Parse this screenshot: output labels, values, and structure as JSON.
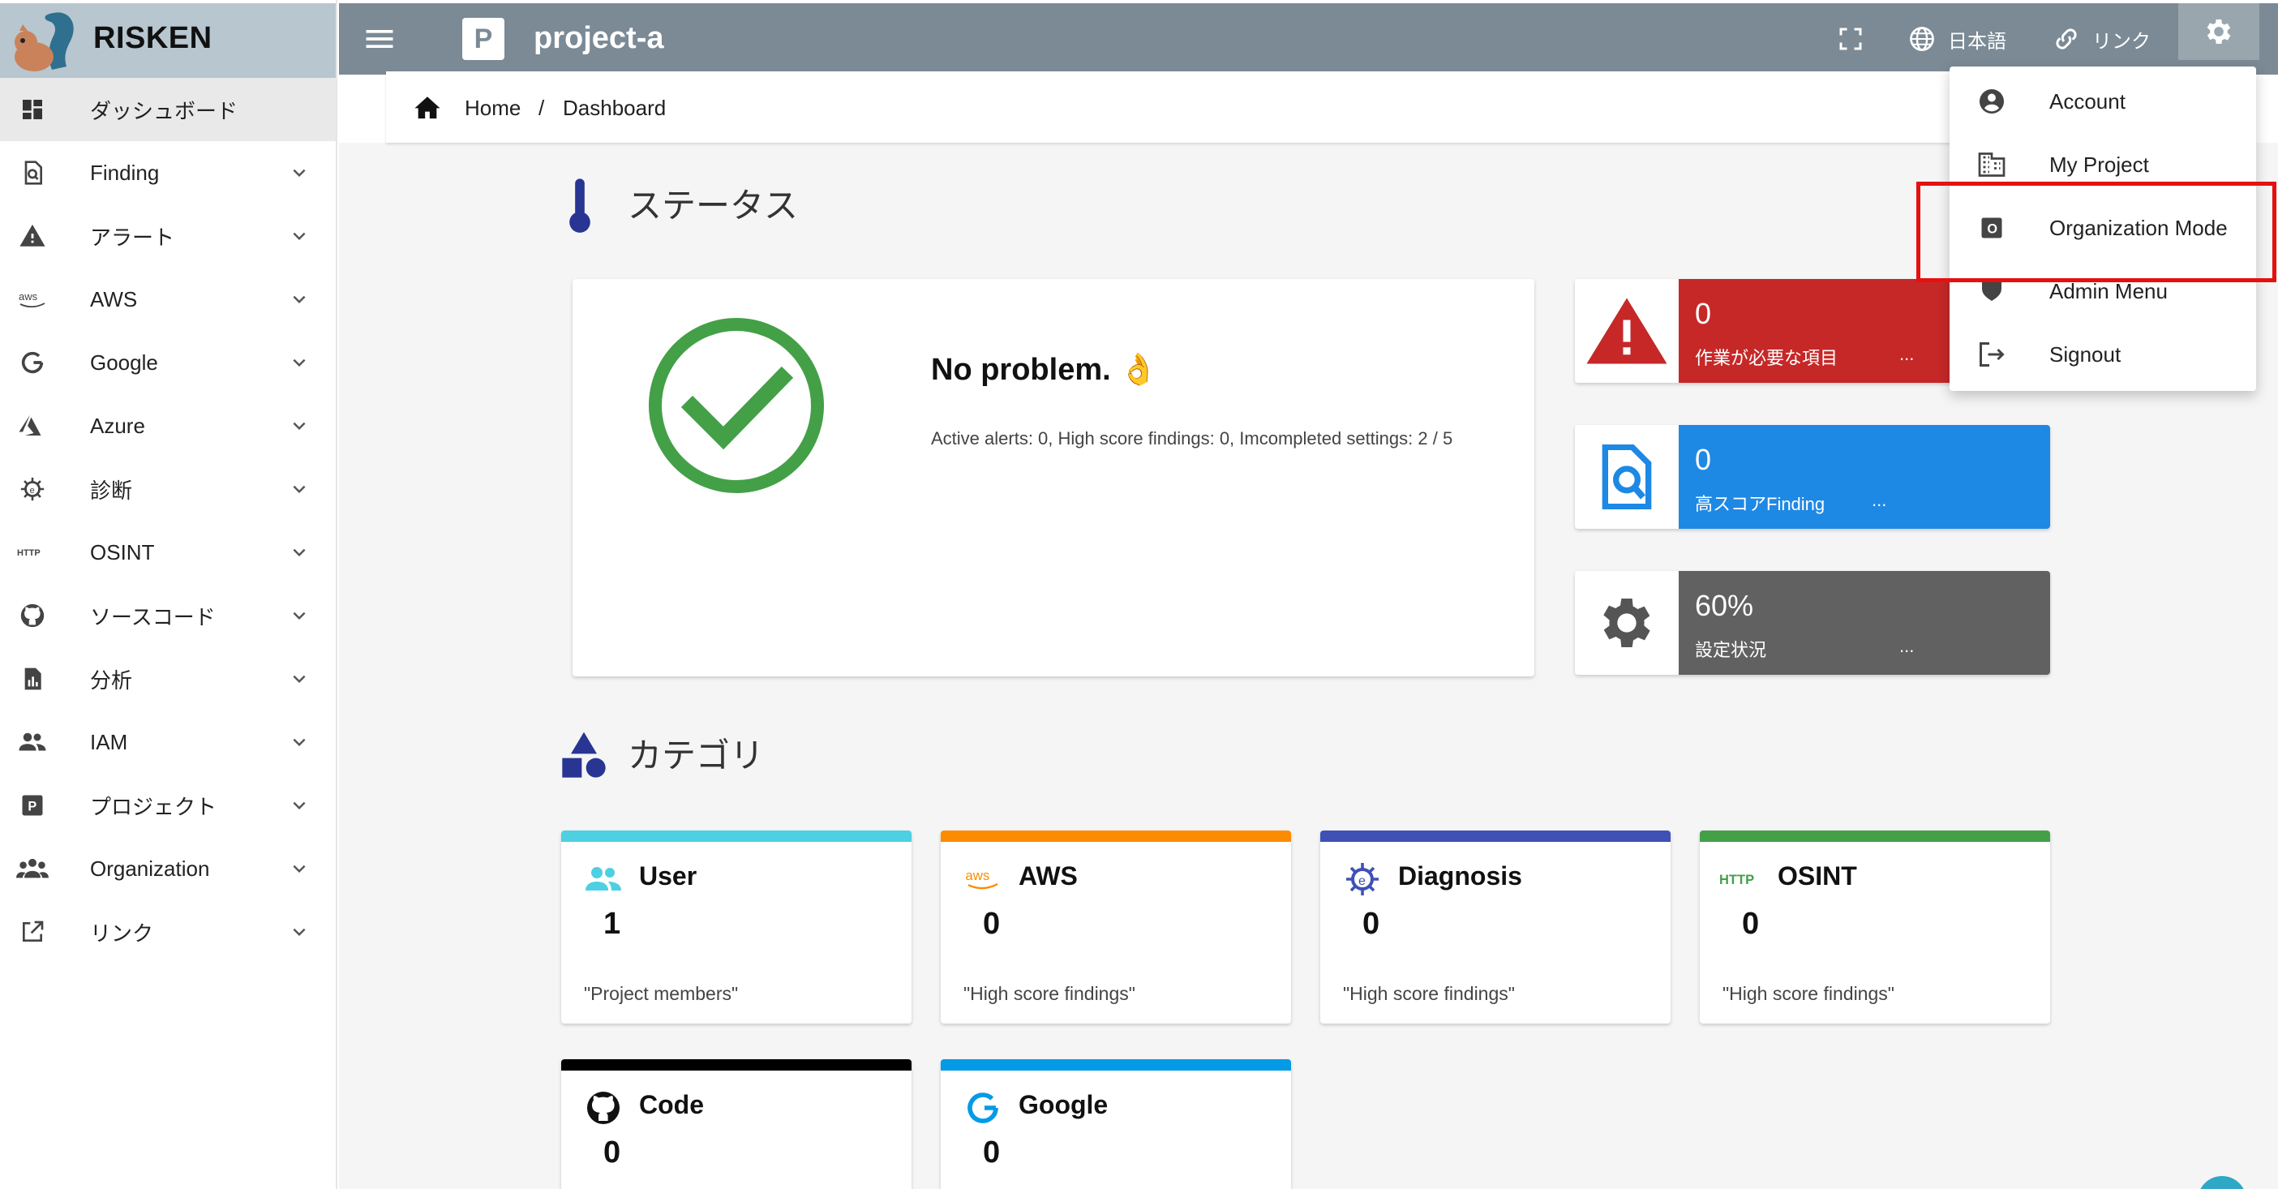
{
  "app": {
    "name": "RISKEN"
  },
  "sidebar": {
    "items": [
      {
        "label": "ダッシュボード",
        "icon": "dashboard-icon",
        "active": true
      },
      {
        "label": "Finding",
        "icon": "finding-icon"
      },
      {
        "label": "アラート",
        "icon": "alert-icon"
      },
      {
        "label": "AWS",
        "icon": "aws-icon"
      },
      {
        "label": "Google",
        "icon": "google-icon"
      },
      {
        "label": "Azure",
        "icon": "azure-icon"
      },
      {
        "label": "診断",
        "icon": "diagnosis-icon"
      },
      {
        "label": "OSINT",
        "icon": "http-icon"
      },
      {
        "label": "ソースコード",
        "icon": "github-icon"
      },
      {
        "label": "分析",
        "icon": "analysis-icon"
      },
      {
        "label": "IAM",
        "icon": "iam-icon"
      },
      {
        "label": "プロジェクト",
        "icon": "project-icon"
      },
      {
        "label": "Organization",
        "icon": "organization-icon"
      },
      {
        "label": "リンク",
        "icon": "link-icon"
      }
    ]
  },
  "header": {
    "project_badge": "P",
    "project_name": "project-a",
    "language_label": "日本語",
    "link_label": "リンク"
  },
  "breadcrumb": {
    "home": "Home",
    "separator": "/",
    "current": "Dashboard"
  },
  "status": {
    "title": "ステータス",
    "headline": "No problem. 👌",
    "summary": "Active alerts: 0, High score findings: 0, Imcompleted settings: 2 / 5"
  },
  "stats": [
    {
      "value": "0",
      "label": "作業が必要な項目",
      "dots": "...",
      "color": "#c62828"
    },
    {
      "value": "0",
      "label": "高スコアFinding",
      "dots": "...",
      "color": "#1e88e5"
    },
    {
      "value": "60%",
      "label": "設定状況",
      "dots": "...",
      "color": "#616161"
    }
  ],
  "category": {
    "title": "カテゴリ",
    "cards": [
      {
        "name": "User",
        "value": "1",
        "desc": "\"Project members\"",
        "color": "#4dd0e1"
      },
      {
        "name": "AWS",
        "value": "0",
        "desc": "\"High score findings\"",
        "color": "#fb8c00"
      },
      {
        "name": "Diagnosis",
        "value": "0",
        "desc": "\"High score findings\"",
        "color": "#3f51b5"
      },
      {
        "name": "OSINT",
        "value": "0",
        "desc": "\"High score findings\"",
        "color": "#43a047"
      },
      {
        "name": "Code",
        "value": "0",
        "desc": "",
        "color": "#000000"
      },
      {
        "name": "Google",
        "value": "0",
        "desc": "",
        "color": "#039be5"
      }
    ]
  },
  "user_menu": {
    "items": [
      {
        "label": "Account",
        "icon": "account-circle-icon"
      },
      {
        "label": "My Project",
        "icon": "building-icon"
      },
      {
        "label": "Organization Mode",
        "icon": "organization-mode-icon",
        "highlighted": true
      },
      {
        "label": "Admin Menu",
        "icon": "admin-icon"
      },
      {
        "label": "Signout",
        "icon": "signout-icon"
      }
    ]
  },
  "colors": {
    "topbar": "#7b8a95",
    "brand_bg": "#b8c6cf",
    "success": "#43a047",
    "highlight": "#e51010"
  }
}
